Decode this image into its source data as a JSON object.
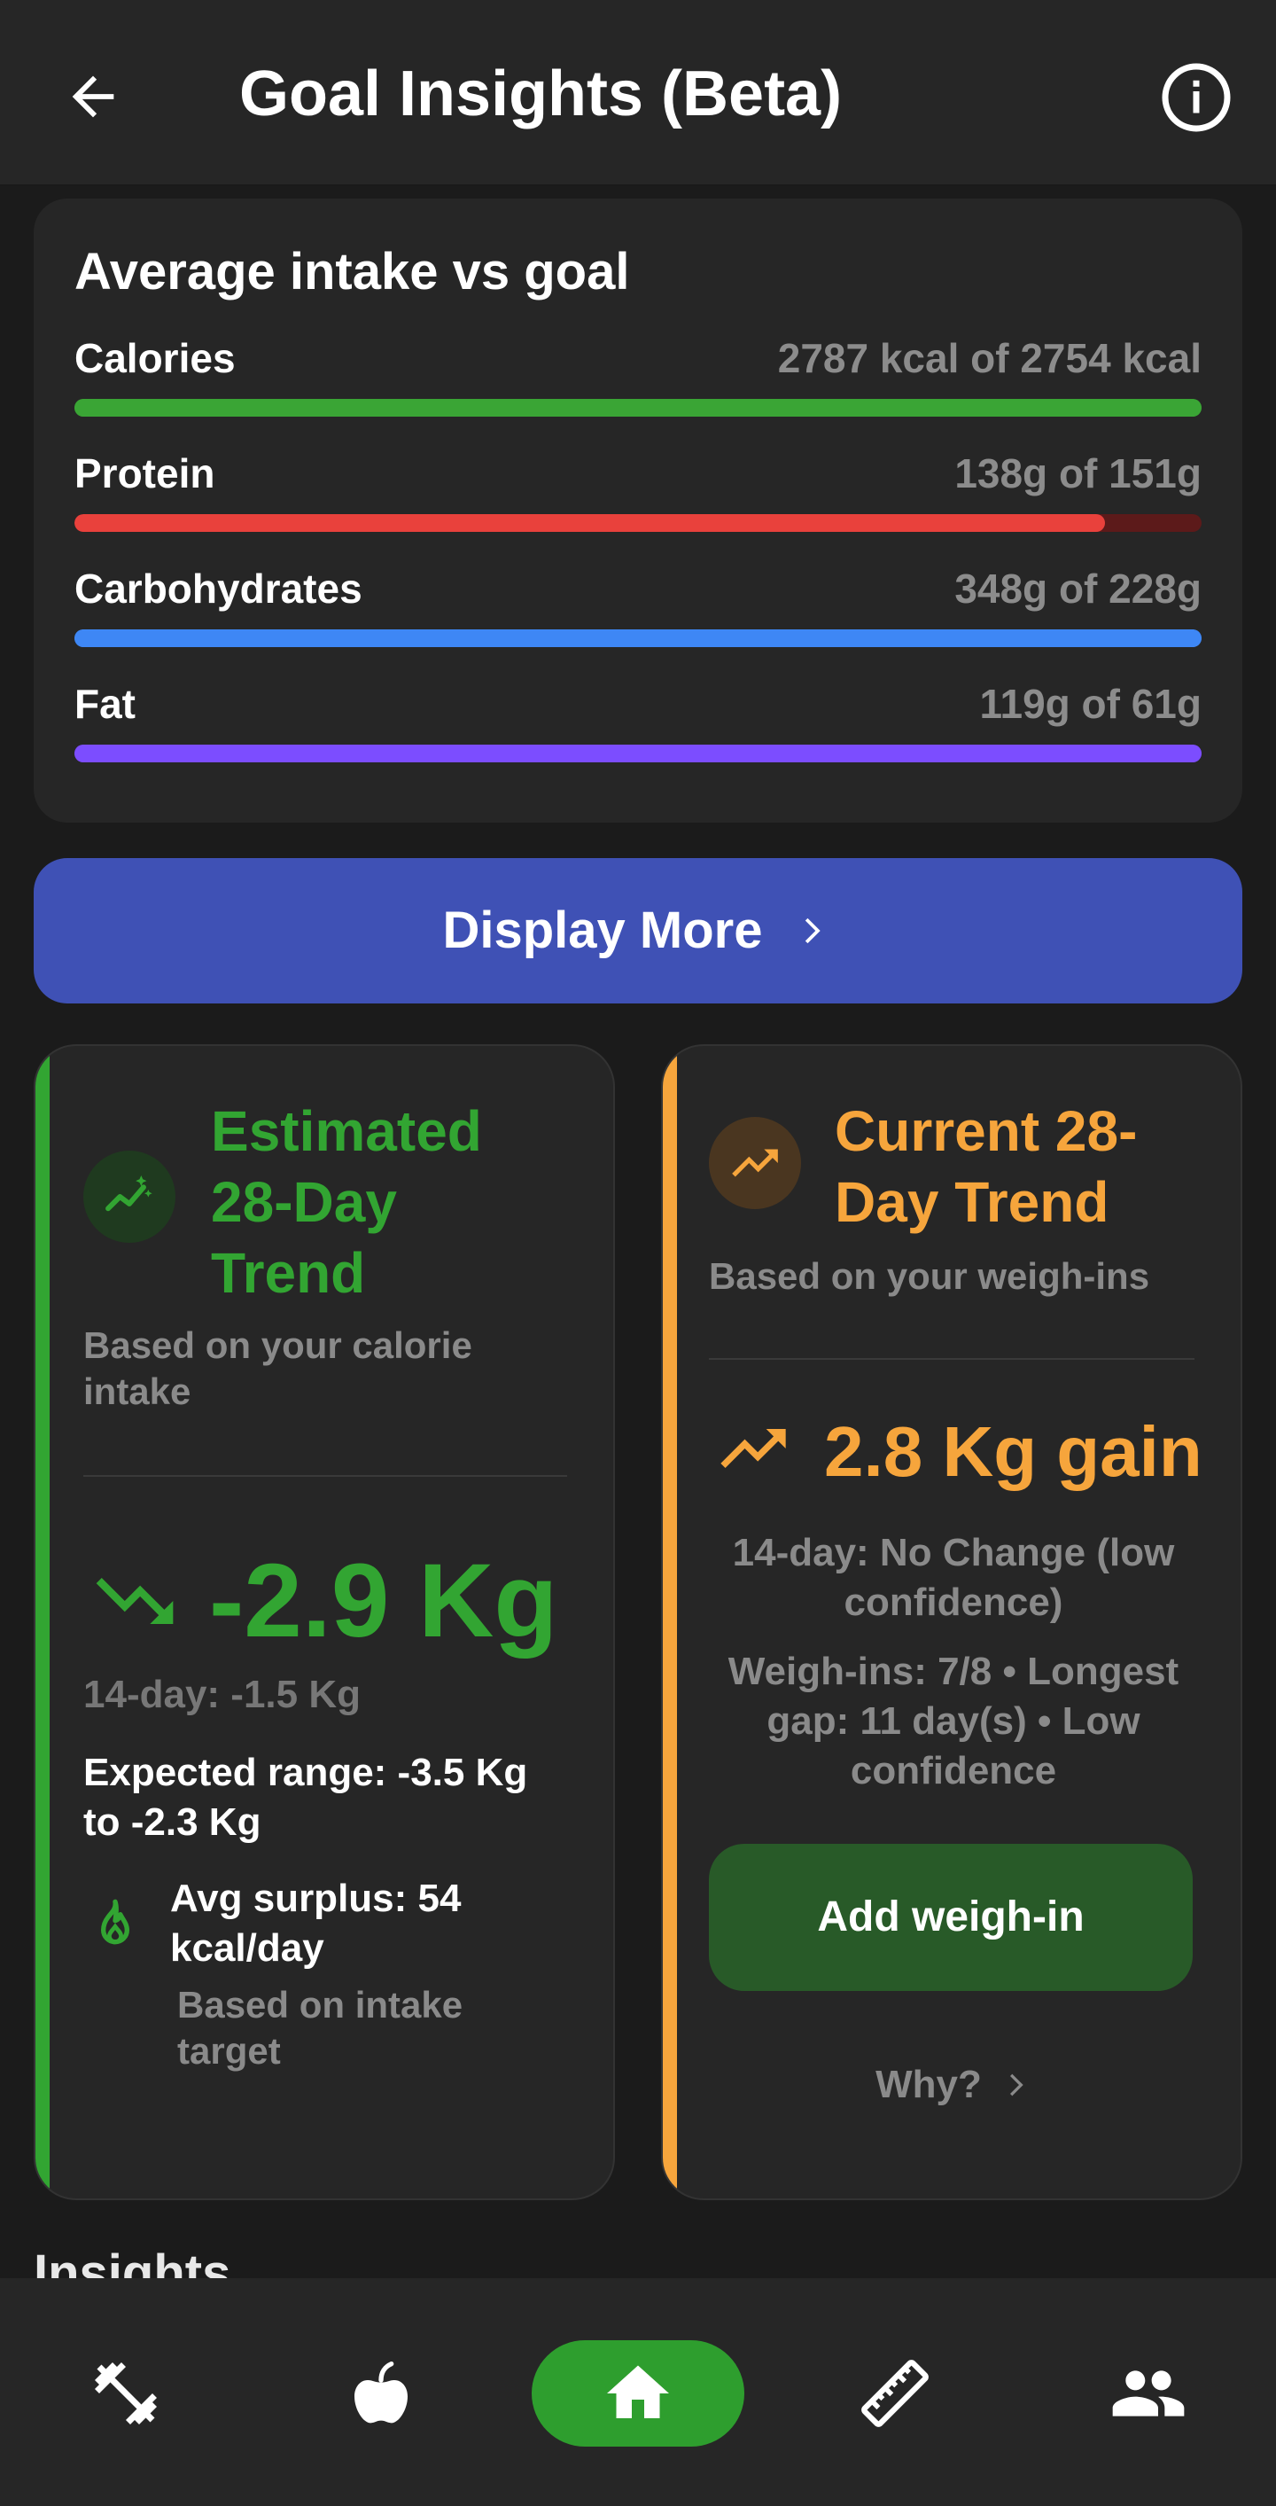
{
  "appbar": {
    "title": "Goal Insights (Beta)",
    "back_icon": "arrow-back-icon",
    "info_icon": "info-icon"
  },
  "intake": {
    "heading": "Average intake vs goal",
    "macros": [
      {
        "label": "Calories",
        "value_text": "2787 kcal of 2754 kcal",
        "progress": 1.0,
        "color": "#3aa535",
        "track": "#3aa535"
      },
      {
        "label": "Protein",
        "value_text": "138g of 151g",
        "progress": 0.914,
        "color": "#e9413c",
        "track": "#5c1a1a"
      },
      {
        "label": "Carbohydrates",
        "value_text": "348g of 228g",
        "progress": 1.0,
        "color": "#3e87f5",
        "track": "#3e87f5"
      },
      {
        "label": "Fat",
        "value_text": "119g of 61g",
        "progress": 1.0,
        "color": "#7c4dff",
        "track": "#7c4dff"
      }
    ]
  },
  "display_more": {
    "label": "Display More"
  },
  "estimated": {
    "title_lines": [
      "Estimated",
      "28-Day",
      "Trend"
    ],
    "subtitle_lines": [
      "Based on your calorie",
      "intake"
    ],
    "value": "-2.9 Kg",
    "fourteen_day": "14-day: -1.5 Kg",
    "range_lines": [
      "Expected range: -3.5 Kg",
      "to -2.3 Kg"
    ],
    "surplus_lines": [
      "Avg surplus: 54",
      "kcal/day"
    ],
    "surplus_note_lines": [
      "Based on intake",
      "target"
    ],
    "accent": "#32a532"
  },
  "current": {
    "title_lines": [
      "Current 28-",
      "Day Trend"
    ],
    "subtitle": "Based on your weigh-ins",
    "value": "2.8 Kg gain",
    "fourteen_day_lines": [
      "14-day: No Change (low",
      "confidence)"
    ],
    "weighins_lines": [
      "Weigh-ins: 7/8 • Longest",
      "gap: 11 day(s) • Low",
      "confidence"
    ],
    "add_button": "Add weigh-in",
    "why_link": "Why?",
    "accent": "#f6a53c"
  },
  "insights_heading": "Insights",
  "nav": {
    "items": [
      "dumbbell-icon",
      "apple-icon",
      "home-icon",
      "ruler-icon",
      "people-icon"
    ],
    "active": "home-icon",
    "active_color": "#2e9e2e"
  }
}
